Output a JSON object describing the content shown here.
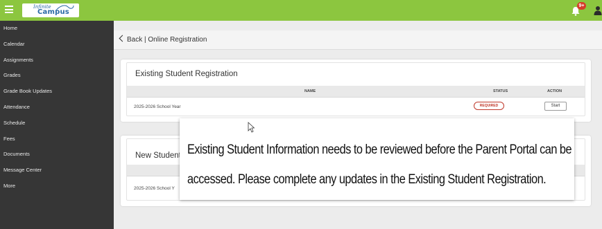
{
  "app": {
    "logo_line1": "Infinite",
    "logo_line2": "Campus",
    "notification_count": "9+",
    "colors": {
      "topbar": "#8cc63f",
      "sidebar": "#363636",
      "required": "#c0392b"
    }
  },
  "sidebar": {
    "items": [
      {
        "label": "Home"
      },
      {
        "label": "Calendar"
      },
      {
        "label": "Assignments"
      },
      {
        "label": "Grades"
      },
      {
        "label": "Grade Book Updates"
      },
      {
        "label": "Attendance"
      },
      {
        "label": "Schedule"
      },
      {
        "label": "Fees"
      },
      {
        "label": "Documents"
      },
      {
        "label": "Message Center"
      },
      {
        "label": "More"
      }
    ]
  },
  "breadcrumb": {
    "label": "Back | Online Registration"
  },
  "existing": {
    "title": "Existing Student Registration",
    "columns": {
      "name": "NAME",
      "status": "STATUS",
      "action": "ACTION"
    },
    "row": {
      "name": "2025-2026 School Year",
      "status": "REQUIRED",
      "action": "Start"
    }
  },
  "new_student": {
    "title": "New Student",
    "row": {
      "name": "2025-2026 School Y"
    }
  },
  "message": {
    "line1": "Existing Student Information needs to be reviewed before the Parent Portal can be",
    "line2": "accessed. Please complete any updates in the Existing Student Registration."
  }
}
